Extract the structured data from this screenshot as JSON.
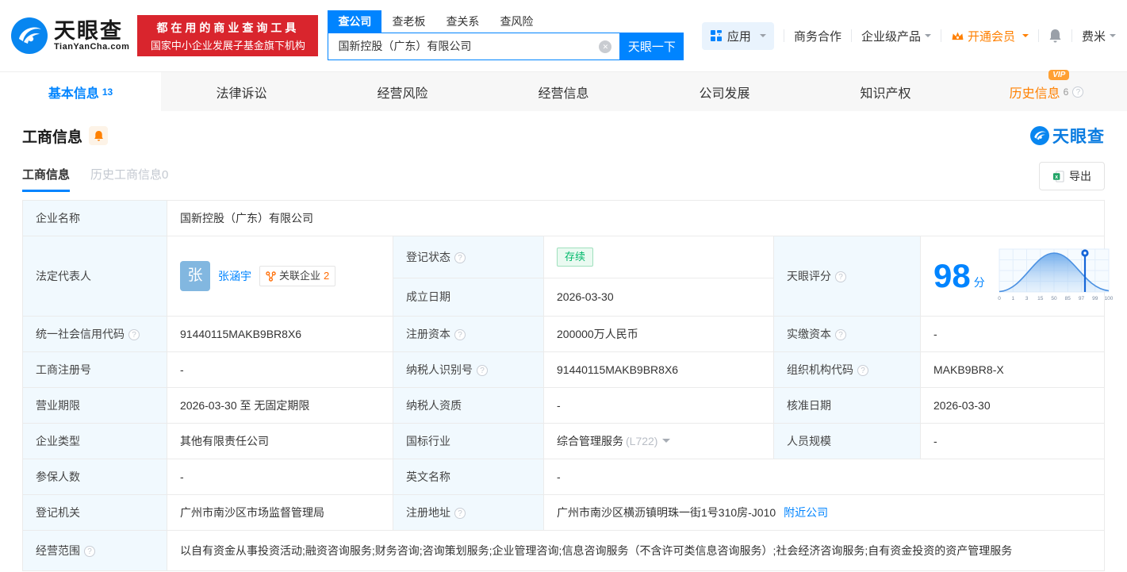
{
  "colors": {
    "accent": "#0084ff",
    "orange": "#ff8000",
    "banner_red": "#d9252d",
    "status_green": "#00b96b"
  },
  "header": {
    "brand": {
      "name": "天眼查",
      "domain": "TianYanCha.com"
    },
    "banner": {
      "line1": "都在用的商业查询工具",
      "line2": "国家中小企业发展子基金旗下机构"
    },
    "search": {
      "tabs": [
        {
          "label": "查公司"
        },
        {
          "label": "查老板"
        },
        {
          "label": "查关系"
        },
        {
          "label": "查风险"
        }
      ],
      "value": "国新控股（广东）有限公司",
      "submit": "天眼一下"
    },
    "menu": {
      "apps": "应用",
      "biz": "商务合作",
      "enterprise": "企业级产品",
      "vip": "开通会员",
      "username": "费米"
    }
  },
  "tabs": [
    {
      "label": "基本信息",
      "count": "13"
    },
    {
      "label": "法律诉讼"
    },
    {
      "label": "经营风险"
    },
    {
      "label": "经营信息"
    },
    {
      "label": "公司发展"
    },
    {
      "label": "知识产权"
    },
    {
      "label": "历史信息",
      "count": "6",
      "badge": "VIP"
    }
  ],
  "section": {
    "title": "工商信息",
    "watermark": "天眼查"
  },
  "subtabs": [
    {
      "label": "工商信息"
    },
    {
      "label": "历史工商信息0"
    }
  ],
  "toolbar": {
    "export_label": "导出"
  },
  "info": {
    "company_name": {
      "label": "企业名称",
      "value": "国新控股（广东）有限公司"
    },
    "legal_rep": {
      "label": "法定代表人",
      "avatar_initial": "张",
      "name": "张涵宇",
      "related_label": "关联企业",
      "related_count": "2"
    },
    "reg_status": {
      "label": "登记状态",
      "value": "存续"
    },
    "establish_date": {
      "label": "成立日期",
      "value": "2026-03-30"
    },
    "score": {
      "label": "天眼评分",
      "value": "98",
      "unit": "分"
    },
    "credit_code": {
      "label": "统一社会信用代码",
      "value": "91440115MAKB9BR8X6"
    },
    "reg_capital": {
      "label": "注册资本",
      "value": "200000万人民币"
    },
    "paid_capital": {
      "label": "实缴资本",
      "value": "-"
    },
    "reg_number": {
      "label": "工商注册号",
      "value": "-"
    },
    "taxpayer_id": {
      "label": "纳税人识别号",
      "value": "91440115MAKB9BR8X6"
    },
    "org_code": {
      "label": "组织机构代码",
      "value": "MAKB9BR8-X"
    },
    "business_term": {
      "label": "营业期限",
      "value": "2026-03-30 至 无固定期限"
    },
    "taxpayer_quality": {
      "label": "纳税人资质",
      "value": "-"
    },
    "approval_date": {
      "label": "核准日期",
      "value": "2026-03-30"
    },
    "company_type": {
      "label": "企业类型",
      "value": "其他有限责任公司"
    },
    "industry": {
      "label": "国标行业",
      "value": "综合管理服务",
      "code": "(L722)"
    },
    "staff_size": {
      "label": "人员规模",
      "value": "-"
    },
    "insured_count": {
      "label": "参保人数",
      "value": "-"
    },
    "english_name": {
      "label": "英文名称",
      "value": "-"
    },
    "reg_authority": {
      "label": "登记机关",
      "value": "广州市南沙区市场监督管理局"
    },
    "reg_address": {
      "label": "注册地址",
      "value": "广州市南沙区横沥镇明珠一街1号310房-J010",
      "link": "附近公司"
    },
    "business_scope": {
      "label": "经营范围",
      "value": "以自有资金从事投资活动;融资咨询服务;财务咨询;咨询策划服务;企业管理咨询;信息咨询服务（不含许可类信息咨询服务）;社会经济咨询服务;自有资金投资的资产管理服务"
    }
  },
  "score_chart": {
    "type": "area",
    "x_ticks": [
      "0",
      "1",
      "3",
      "15",
      "50",
      "85",
      "97",
      "99",
      "100"
    ],
    "marker_value": 98,
    "peak_tick": "50"
  }
}
